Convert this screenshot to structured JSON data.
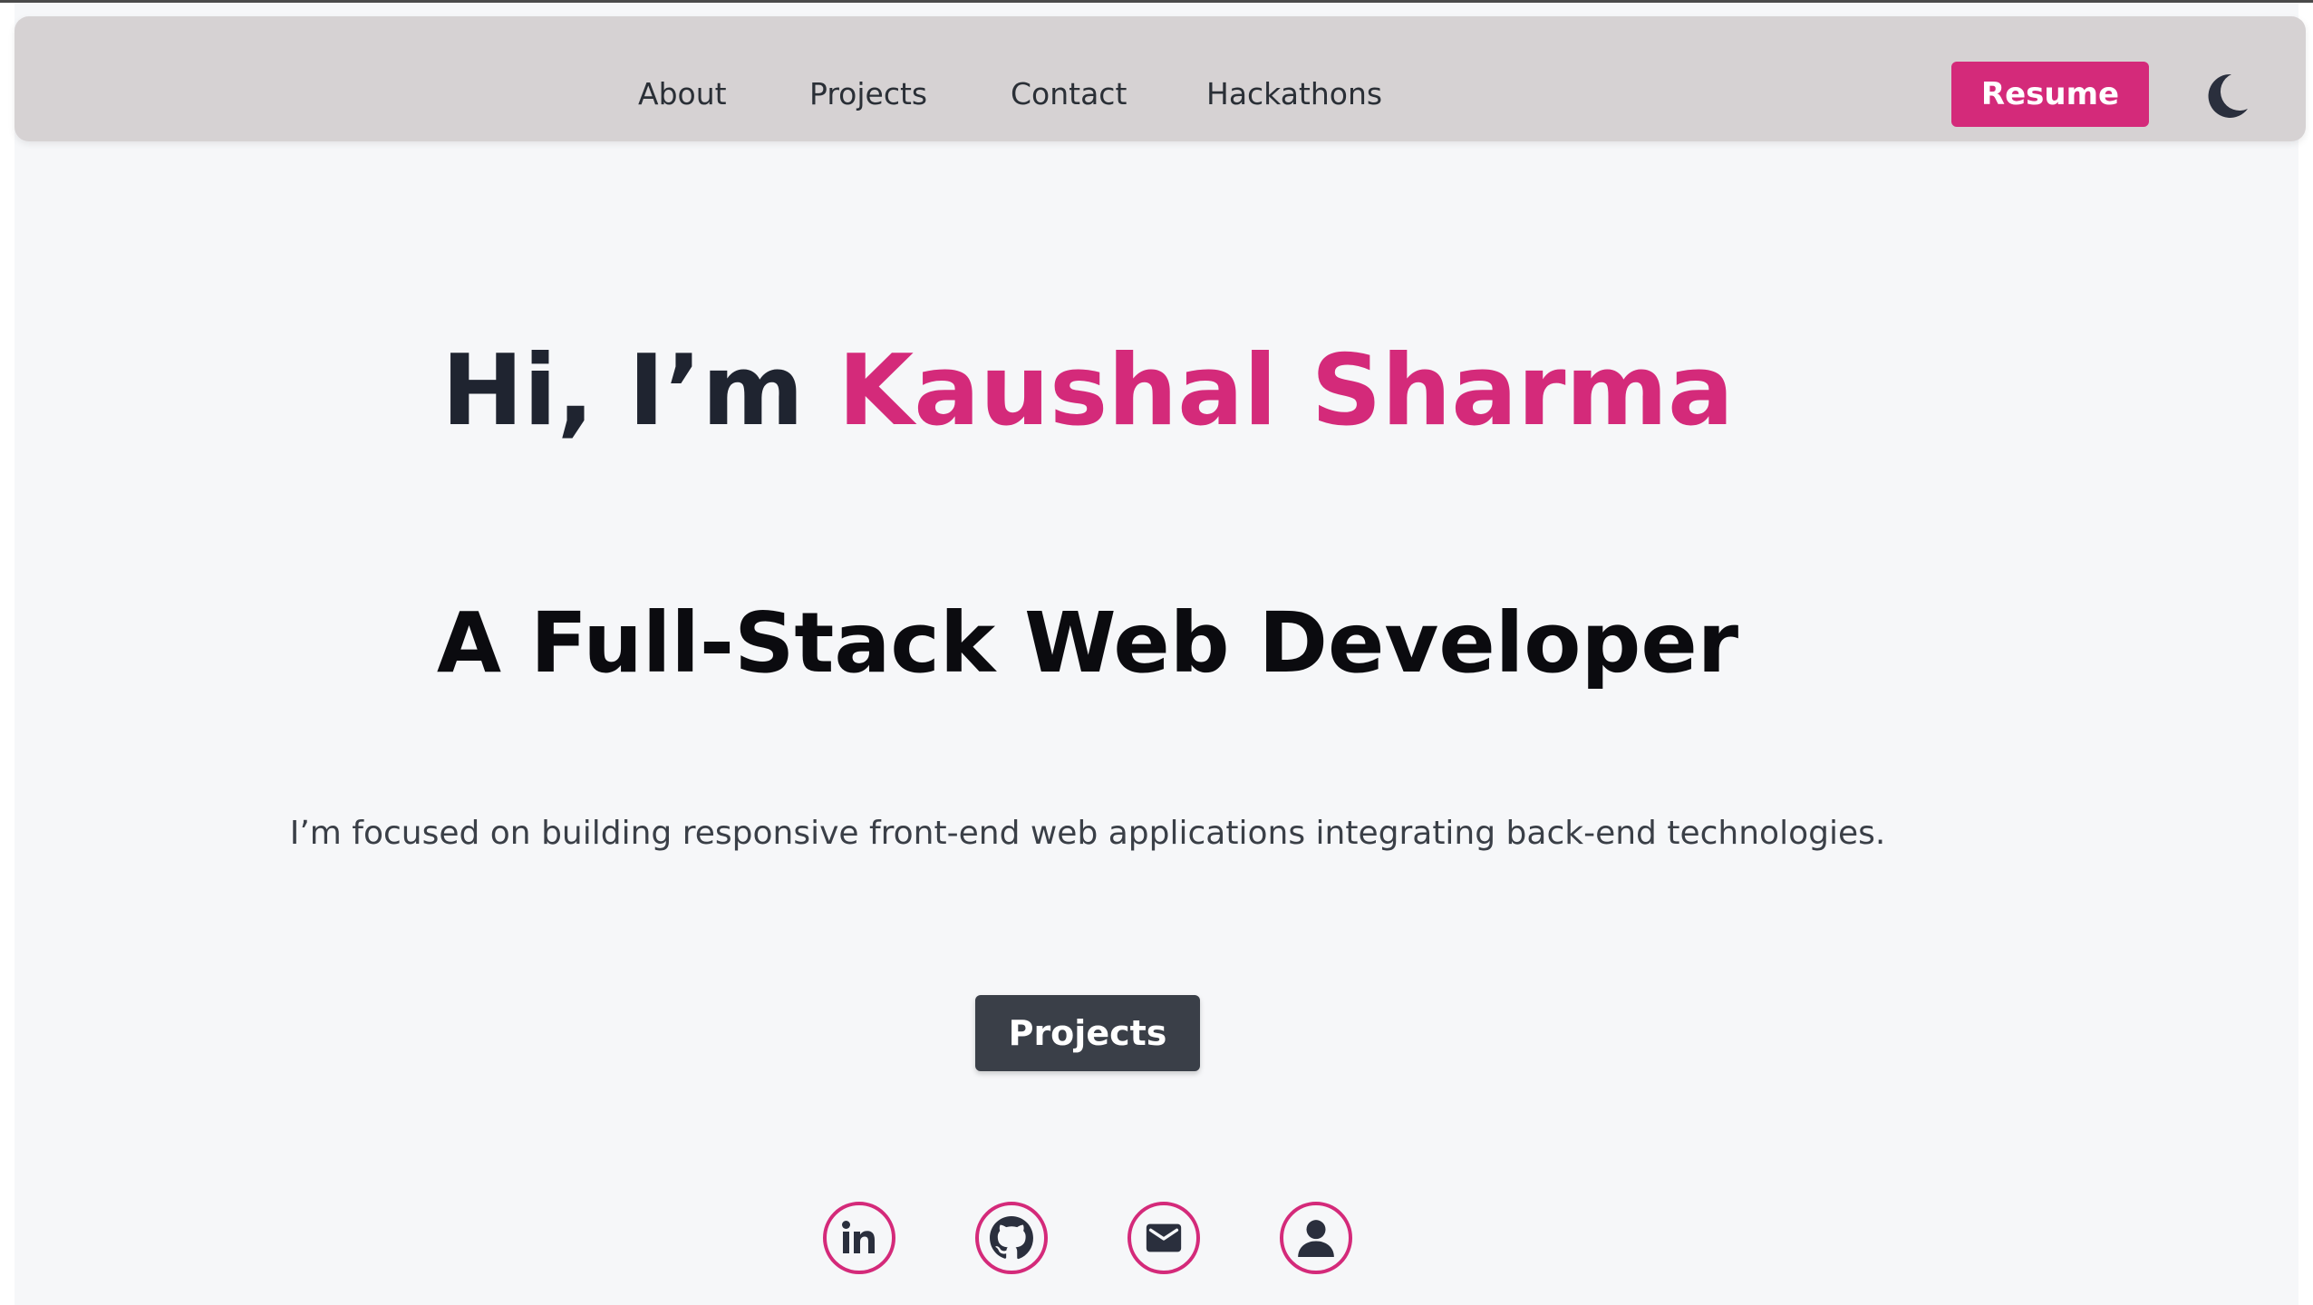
{
  "nav": {
    "links": [
      "About",
      "Projects",
      "Contact",
      "Hackathons"
    ],
    "resume_label": "Resume",
    "theme_icon": "moon-icon"
  },
  "hero": {
    "greeting": "Hi, I’m ",
    "name": "Kaushal Sharma",
    "role": "A Full-Stack Web Developer",
    "description": "I’m focused on building responsive front-end web applications integrating back-end technologies.",
    "projects_button": "Projects"
  },
  "social_icons": [
    "linkedin-icon",
    "github-icon",
    "mail-icon",
    "user-icon"
  ],
  "colors": {
    "accent": "#d42a7a",
    "navbar_bg": "#d6d2d3",
    "page_bg": "#f6f7f9",
    "dark_button": "#3a3f48",
    "heading": "#1f2430"
  }
}
